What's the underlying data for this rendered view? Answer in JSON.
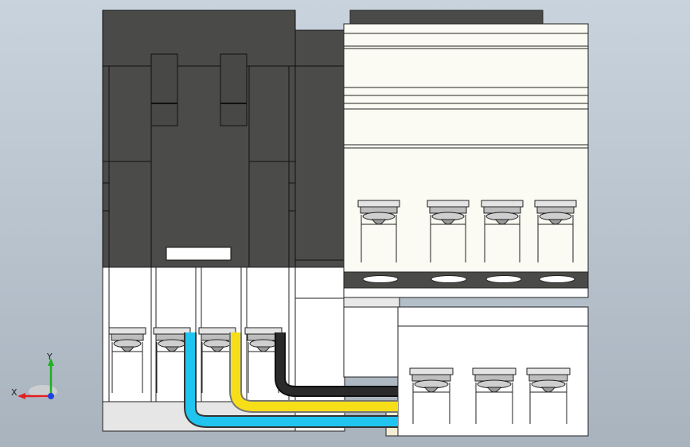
{
  "triad": {
    "x_label": "X",
    "y_label": "Y"
  },
  "colors": {
    "background_top": "#c9d3dd",
    "body_dark": "#4a4b48",
    "terminal_white": "#ffffff",
    "panel_cream": "#fbfbf3",
    "wire_cyan": "#1fc4ef",
    "wire_yellow": "#f6df18",
    "wire_black": "#2a2a2a",
    "axis_x": "#e02020",
    "axis_y": "#20b020",
    "axis_z": "#2040e0"
  }
}
